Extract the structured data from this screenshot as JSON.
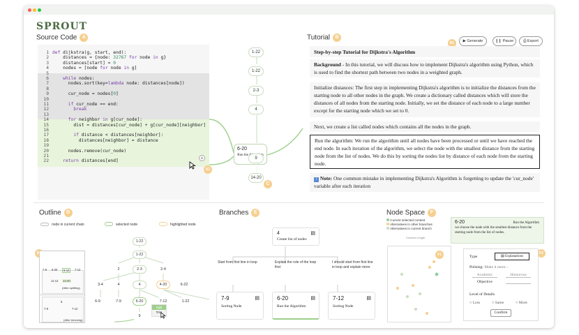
{
  "app": {
    "logo": "SPROUT"
  },
  "colors": {
    "accent_green": "#9ccf8a",
    "badge_orange": "#f6cf8e",
    "highlight_green": "#e8f4dc",
    "selected_gray": "#e3e3e3"
  },
  "source": {
    "title": "Source Code",
    "badge": "A",
    "badge_a1": "A1",
    "lines": [
      {
        "n": "1",
        "code": "def dijkstra(g, start, end):"
      },
      {
        "n": "2",
        "code": "    distances = {node: 32767 for node in g}"
      },
      {
        "n": "3",
        "code": "    distances[start] = 0"
      },
      {
        "n": "4",
        "code": "    nodes = [node for node in g]"
      },
      {
        "n": "5",
        "code": ""
      },
      {
        "n": "6",
        "code": "    while nodes:"
      },
      {
        "n": "7",
        "code": "      nodes.sort(key=lambda node: distances[node])"
      },
      {
        "n": "8",
        "code": ""
      },
      {
        "n": "9",
        "code": "      cur_node = nodes[0]"
      },
      {
        "n": "10",
        "code": ""
      },
      {
        "n": "11",
        "code": "      if cur_node == end:"
      },
      {
        "n": "12",
        "code": "        break"
      },
      {
        "n": "13",
        "code": ""
      },
      {
        "n": "14",
        "code": "      for neighbor in g[cur_node]:"
      },
      {
        "n": "15",
        "code": "        dist = distances[cur_node] + g[cur_node][neighbor]"
      },
      {
        "n": "16",
        "code": ""
      },
      {
        "n": "17",
        "code": "        if distance < distances[neighbor]:"
      },
      {
        "n": "18",
        "code": "          distances[neighbor] = distance"
      },
      {
        "n": "19",
        "code": ""
      },
      {
        "n": "20",
        "code": "      nodes.remove(cur_node)"
      },
      {
        "n": "21",
        "code": ""
      },
      {
        "n": "22",
        "code": "    return distances[end]"
      }
    ]
  },
  "chain": {
    "chips": [
      "1-22",
      "1-22",
      "2-3",
      "4",
      "9",
      "14-20"
    ],
    "selected_range": "6-20",
    "selected_label": "Run the Algorithm",
    "badge": "C"
  },
  "tutorial": {
    "title": "Tutorial",
    "badge": "B",
    "badge_b1": "B1",
    "buttons": {
      "generate": "Generate",
      "pause": "Pause",
      "export": "Export"
    },
    "heading": "Step-by-step Tutorial for Dijkstra's Algorithm",
    "background_label": "Background",
    "background_text": " - In this tutorial, we will discuss how to implement Dijkstra's algorithm using Python, which is used to find the shortest path between two nodes in a weighted graph.",
    "p1": "Initialize distances: The first step in implementing Dijkstra's algorithm is to initialize the distances from the starting node to all other nodes in the graph. We create a dictionary called distances which will store the distances of all nodes from the starting node. Initially, we set the distance of each node to a large number except for the starting node which we set to 0.",
    "p2": "Next, we create a list called nodes which contains all the nodes in the graph.",
    "p3": "Run the algorithm: We run the algorithm until all nodes have been processed or until we have reached the end node. In each iteration of the algorithm, we select the node with the smallest distance from the starting node from the list of nodes. We do this by sorting the nodes list by distance of each node from the starting node.",
    "note_label": "Note:",
    "note_text": " One common mistake in implementing Dijkstra's Algorithm is forgetting to update the 'cur_node'  variable after each iteration"
  },
  "outline": {
    "title": "Outline",
    "badge": "D",
    "badge_d1": "D1",
    "legend": {
      "chain": "node in current chain",
      "selected": "selected node",
      "highlighted": "highlighted node"
    },
    "nodes": {
      "top1": "1-22",
      "top2": "1-22",
      "r2a": "2",
      "r2b": "2-3",
      "r2c": "2-4",
      "r3a": "3-4",
      "r3b": "4",
      "r3c": "4",
      "r3d": "4-20",
      "r3e": "6-22",
      "r4a": "6-9",
      "r4b": "7-9",
      "r4c": "6-20",
      "r4d": "7-12",
      "r4e": "1-22",
      "r5": "9"
    },
    "menu": {
      "split": "Split",
      "trim": "Trim"
    },
    "mini": {
      "top": [
        "7-9",
        "6-20",
        "6-12",
        "7-12"
      ],
      "sub": [
        "11-12",
        "14-20"
      ],
      "after_split": "(After splitting)",
      "bottom": [
        "7-9",
        "6",
        "7-12"
      ],
      "after_trim": "(After trimming)"
    }
  },
  "branches": {
    "title": "Branches",
    "badge": "E",
    "root": {
      "range": "4",
      "label": "Create list of nodes"
    },
    "options": [
      "Start from first line in loop",
      "Explain the role of the loop first",
      "I should start from first line in loop and explain more"
    ],
    "cards": [
      {
        "range": "7-9",
        "label": "Sorting Node"
      },
      {
        "range": "6-20",
        "label": "Run the Algorithm"
      },
      {
        "range": "7-12",
        "label": "Sorting Node"
      }
    ]
  },
  "nodespace": {
    "title": "Node Space",
    "badge": "F",
    "badge_f1": "F1",
    "badge_f2": "F2",
    "legend": [
      "Current selected content",
      "Alternatives in other branches",
      "Alternatives in current branch"
    ],
    "axis_label": "Content Length",
    "card": {
      "range": "6-20",
      "label": "Run the Algorithm",
      "text": "we choose the node with the smallest distance from the starting node from the list of nodes."
    },
    "controls": {
      "type_label": "Type",
      "type_value": "Explanations",
      "polish_label": "Polising:",
      "polish_hint": "Make it more...",
      "academic": "Academic",
      "humorous": "Humorous",
      "objective": "Objective",
      "level_label": "Level of Details",
      "levels": [
        "Less",
        "Same",
        "More"
      ],
      "confirm": "Confirm"
    }
  }
}
